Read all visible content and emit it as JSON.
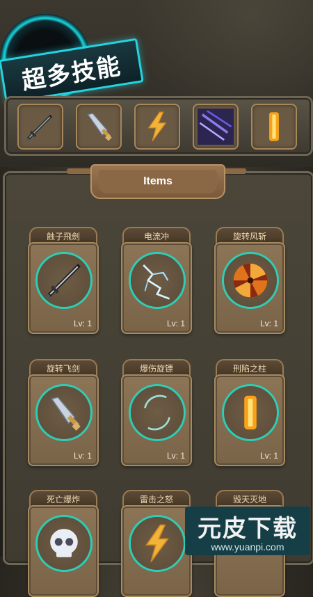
{
  "banner": {
    "title": "超多技能"
  },
  "skill_bar": {
    "slots": [
      {
        "icon": "dark-sword-icon"
      },
      {
        "icon": "silver-dagger-icon"
      },
      {
        "icon": "lightning-icon"
      },
      {
        "icon": "purple-meteor-icon"
      },
      {
        "icon": "fire-pillar-icon"
      }
    ]
  },
  "panel": {
    "tab_label": "Items"
  },
  "items": [
    {
      "name": "蝕子飛劍",
      "level": "Lv: 1",
      "icon": "dark-sword-icon"
    },
    {
      "name": "电流冲",
      "level": "Lv: 1",
      "icon": "lightning-bolt-icon"
    },
    {
      "name": "旋转风斩",
      "level": "Lv: 1",
      "icon": "fire-vortex-icon"
    },
    {
      "name": "旋转飞剑",
      "level": "Lv: 1",
      "icon": "silver-dagger-icon"
    },
    {
      "name": "爆伤旋镖",
      "level": "Lv: 1",
      "icon": "crescent-blade-icon"
    },
    {
      "name": "刑陷之柱",
      "level": "Lv: 1",
      "icon": "fire-pillar-icon"
    },
    {
      "name": "死亡爆炸",
      "level": "",
      "icon": "skull-icon"
    },
    {
      "name": "雷击之怒",
      "level": "",
      "icon": "lightning-icon"
    },
    {
      "name": "毁天灭地",
      "level": "",
      "icon": "purple-meteor-icon"
    }
  ],
  "watermark": {
    "title": "元皮下载",
    "url": "www.yuanpi.com"
  },
  "colors": {
    "ring": "#2ecdb6",
    "banner_border": "#25d3de"
  }
}
